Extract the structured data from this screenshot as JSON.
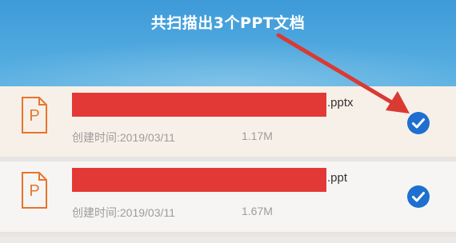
{
  "header": {
    "title": "共扫描出3个PPT文档"
  },
  "files": [
    {
      "icon_letter": "P",
      "name_suffix": ".pptx",
      "created": "创建时间:2019/03/11",
      "size": "1.17M",
      "selected": true
    },
    {
      "icon_letter": "P",
      "name_suffix": ".ppt",
      "created": "创建时间:2019/03/11",
      "size": "1.67M",
      "selected": true
    }
  ],
  "colors": {
    "header_blue": "#4ea8de",
    "redaction_red": "#e33936",
    "annotation_arrow": "#d93a34",
    "check_blue": "#1e6fcf",
    "ppt_orange": "#e8742c"
  }
}
